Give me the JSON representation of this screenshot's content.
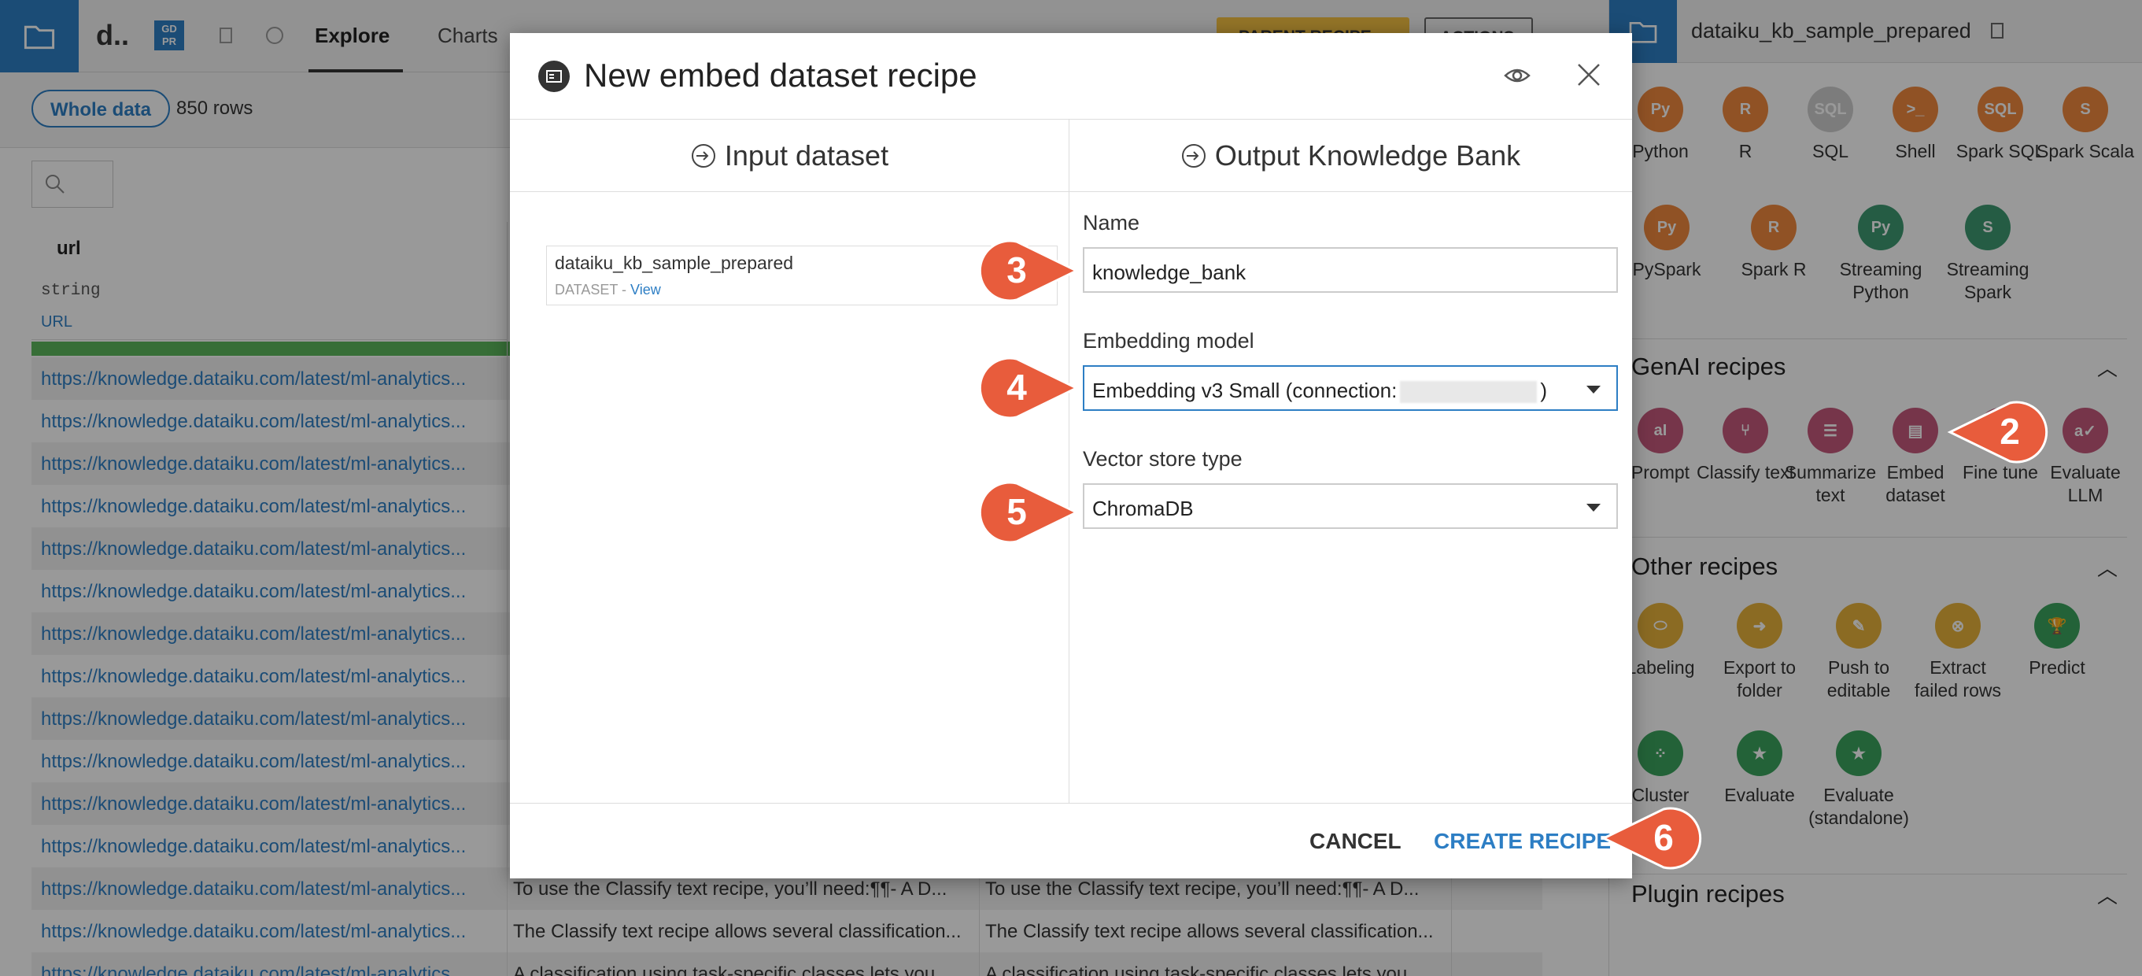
{
  "app": {
    "dataset_short": "d..",
    "gdpr_badge": "GD PR",
    "tabs": [
      "Explore",
      "Charts"
    ],
    "parent_recipe_label": "PARENT RECIPE",
    "actions_label": "ACTIONS",
    "sample_label": "Whole data",
    "row_count": "850 rows"
  },
  "table": {
    "column": {
      "name": "url",
      "type": "string",
      "meaning": "URL"
    },
    "rows": [
      {
        "url": "https://knowledge.dataiku.com/latest/ml-analytics...",
        "a": "",
        "b": ""
      },
      {
        "url": "https://knowledge.dataiku.com/latest/ml-analytics...",
        "a": "",
        "b": ""
      },
      {
        "url": "https://knowledge.dataiku.com/latest/ml-analytics...",
        "a": "",
        "b": ""
      },
      {
        "url": "https://knowledge.dataiku.com/latest/ml-analytics...",
        "a": "",
        "b": ""
      },
      {
        "url": "https://knowledge.dataiku.com/latest/ml-analytics...",
        "a": "",
        "b": ""
      },
      {
        "url": "https://knowledge.dataiku.com/latest/ml-analytics...",
        "a": "",
        "b": ""
      },
      {
        "url": "https://knowledge.dataiku.com/latest/ml-analytics...",
        "a": "",
        "b": ""
      },
      {
        "url": "https://knowledge.dataiku.com/latest/ml-analytics...",
        "a": "",
        "b": ""
      },
      {
        "url": "https://knowledge.dataiku.com/latest/ml-analytics...",
        "a": "",
        "b": ""
      },
      {
        "url": "https://knowledge.dataiku.com/latest/ml-analytics...",
        "a": "",
        "b": ""
      },
      {
        "url": "https://knowledge.dataiku.com/latest/ml-analytics...",
        "a": "",
        "b": ""
      },
      {
        "url": "https://knowledge.dataiku.com/latest/ml-analytics...",
        "a": "",
        "b": ""
      },
      {
        "url": "https://knowledge.dataiku.com/latest/ml-analytics...",
        "a": "To use the Classify text recipe, you’ll need:¶¶- A D...",
        "b": "To use the Classify text recipe, you’ll need:¶¶- A D..."
      },
      {
        "url": "https://knowledge.dataiku.com/latest/ml-analytics...",
        "a": "The Classify text recipe allows several classification...",
        "b": "The Classify text recipe allows several classification..."
      },
      {
        "url": "https://knowledge.dataiku.com/latest/ml-analytics...",
        "a": "A classification using task-specific classes lets you ...",
        "b": "A classification using task-specific classes lets you ..."
      }
    ]
  },
  "right_panel": {
    "title": "dataiku_kb_sample_prepared",
    "code_recipes": [
      {
        "label": "Python",
        "color": "#f0883e",
        "glyph": "Py"
      },
      {
        "label": "R",
        "color": "#f0883e",
        "glyph": "R"
      },
      {
        "label": "SQL",
        "color": "#cfcfcf",
        "glyph": "SQL"
      },
      {
        "label": "Shell",
        "color": "#f0883e",
        "glyph": ">_"
      },
      {
        "label": "Spark SQL",
        "color": "#f0883e",
        "glyph": "SQL"
      },
      {
        "label": "Spark Scala",
        "color": "#f0883e",
        "glyph": "S"
      },
      {
        "label": "PySpark",
        "color": "#f0883e",
        "glyph": "Py"
      },
      {
        "label": "Spark R",
        "color": "#f0883e",
        "glyph": "R"
      },
      {
        "label": "Streaming Python",
        "color": "#3e9a72",
        "glyph": "Py"
      },
      {
        "label": "Streaming Spark",
        "color": "#3e9a72",
        "glyph": "S"
      }
    ],
    "genai_title": "GenAI recipes",
    "genai_recipes": [
      {
        "label": "Prompt",
        "color": "#c4587b",
        "glyph": "aI"
      },
      {
        "label": "Classify text",
        "color": "#c4587b",
        "glyph": "⑂"
      },
      {
        "label": "Summarize text",
        "color": "#c4587b",
        "glyph": "☰"
      },
      {
        "label": "Embed dataset",
        "color": "#c4587b",
        "glyph": "▤"
      },
      {
        "label": "Fine tune",
        "color": "#c4587b",
        "glyph": "◐"
      },
      {
        "label": "Evaluate LLM",
        "color": "#c4587b",
        "glyph": "a✓"
      }
    ],
    "other_title": "Other recipes",
    "other_recipes": [
      {
        "label": "Labeling",
        "color": "#e8b33a",
        "glyph": "⬭"
      },
      {
        "label": "Export to folder",
        "color": "#e8b33a",
        "glyph": "➜"
      },
      {
        "label": "Push to editable",
        "color": "#e8b33a",
        "glyph": "✎"
      },
      {
        "label": "Extract failed rows",
        "color": "#e8b33a",
        "glyph": "⊗"
      },
      {
        "label": "Predict",
        "color": "#3aa45e",
        "glyph": "🏆"
      },
      {
        "label": "Cluster",
        "color": "#3aa45e",
        "glyph": "⁘"
      },
      {
        "label": "Evaluate",
        "color": "#3aa45e",
        "glyph": "★"
      },
      {
        "label": "Evaluate (standalone)",
        "color": "#3aa45e",
        "glyph": "★"
      }
    ],
    "plugin_title": "Plugin recipes"
  },
  "modal": {
    "title": "New embed dataset recipe",
    "input_heading": "Input dataset",
    "output_heading": "Output Knowledge Bank",
    "input_name": "dataiku_kb_sample_prepared",
    "input_type": "DATASET",
    "input_sep": " - ",
    "input_view": "View",
    "name_label": "Name",
    "name_value": "knowledge_bank",
    "embedding_label": "Embedding model",
    "embedding_value": "Embedding v3 Small (connection:",
    "embedding_suffix": ")",
    "vector_label": "Vector store type",
    "vector_value": "ChromaDB",
    "cancel_label": "CANCEL",
    "create_label": "CREATE RECIPE"
  },
  "callouts": [
    "3",
    "4",
    "5",
    "2",
    "6"
  ],
  "colors": {
    "accent": "#2d7ec4",
    "callout": "#e85c3c",
    "data_ok": "#5cb85c"
  }
}
